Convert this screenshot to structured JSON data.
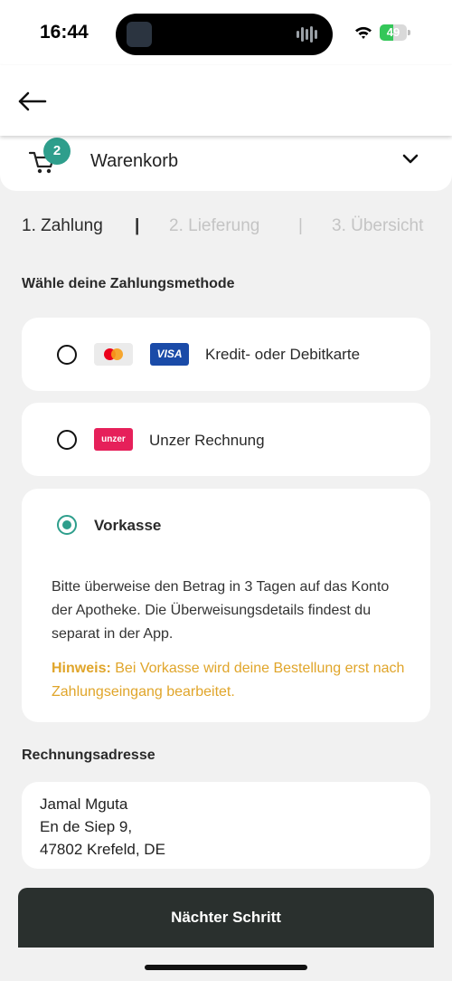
{
  "status_bar": {
    "time": "16:44",
    "battery": "49",
    "battery_level": 0.49,
    "battery_color": "#34c759"
  },
  "nav": {
    "back_icon": "arrow-left-icon"
  },
  "cart": {
    "icon": "cart-icon",
    "badge_count": "2",
    "label": "Warenkorb",
    "chevron_icon": "chevron-down-icon"
  },
  "steps": [
    {
      "label": "1. Zahlung",
      "active": true
    },
    {
      "label": "2. Lieferung",
      "active": false
    },
    {
      "label": "3. Übersicht",
      "active": false
    }
  ],
  "step_separator": "|",
  "payment": {
    "heading": "Wähle deine Zahlungsmethode",
    "methods": [
      {
        "label": "Kredit- oder Debitkarte",
        "logos": [
          "mastercard-logo",
          "visa-logo"
        ],
        "visa_text": "VISA",
        "selected": false
      },
      {
        "label": "Unzer Rechnung",
        "logos": [
          "unzer-logo"
        ],
        "unzer_text": "unzer",
        "selected": false
      },
      {
        "label": "Vorkasse",
        "selected": true,
        "description": "Bitte überweise den Betrag in 3 Tagen auf das Konto der Apotheke. Die Überweisungsdetails findest du separat in der App.",
        "hint_label": "Hinweis:",
        "hint_text": " Bei Vorkasse wird deine Bestellung erst nach Zahlungseingang bearbeitet."
      }
    ]
  },
  "billing": {
    "heading": "Rechnungsadresse",
    "lines": [
      "Jamal Mguta",
      "En de Siep 9,",
      "47802 Krefeld, DE"
    ]
  },
  "next_button": "Nächter Schritt",
  "colors": {
    "accent": "#2e9e8c",
    "hint": "#e0a52a",
    "button_bg": "#2a302e",
    "background": "#f1f1f1"
  }
}
